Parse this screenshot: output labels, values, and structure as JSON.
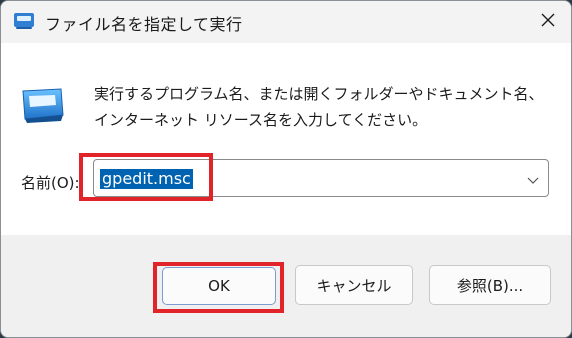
{
  "window": {
    "title": "ファイル名を指定して実行"
  },
  "dialog": {
    "description": "実行するプログラム名、または開くフォルダーやドキュメント名、インターネット リソース名を入力してください。",
    "name_label": "名前(O):",
    "input_value": "gpedit.msc"
  },
  "buttons": {
    "ok": "OK",
    "cancel": "キャンセル",
    "browse": "参照(B)..."
  },
  "colors": {
    "highlight_box": "#e0242a",
    "selection": "#0063b1",
    "accent": "#3d8ad8"
  },
  "icons": [
    "run-icon",
    "close-icon",
    "chevron-down-icon"
  ]
}
